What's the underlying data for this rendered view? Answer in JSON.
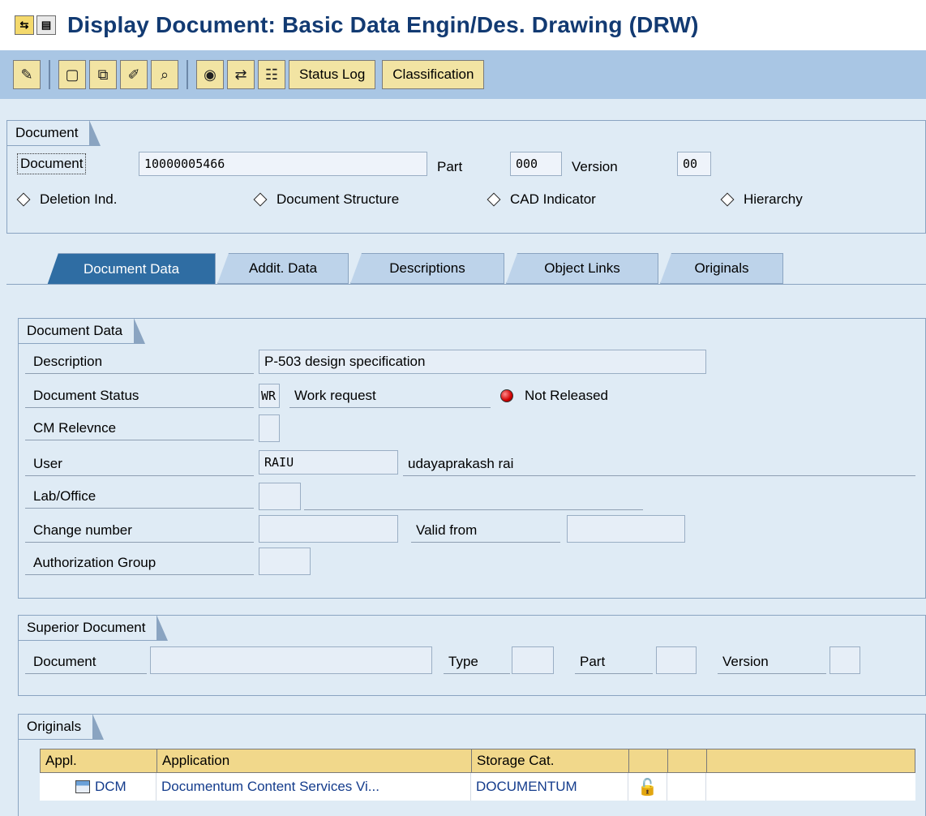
{
  "title": "Display Document: Basic Data Engin/Des. Drawing (DRW)",
  "toolbar": {
    "icons": [
      "edit-mode-icon",
      "new-document-icon",
      "copy-icon",
      "change-icon",
      "find-icon",
      "display-icon",
      "navigate-icon",
      "structure-icon"
    ],
    "status_log": "Status Log",
    "classification": "Classification"
  },
  "header": {
    "group_title": "Document",
    "document_label": "Document",
    "document_value": "10000005466",
    "part_label": "Part",
    "part_value": "000",
    "version_label": "Version",
    "version_value": "00",
    "deletion_ind": "Deletion Ind.",
    "document_structure": "Document Structure",
    "cad_indicator": "CAD Indicator",
    "hierarchy": "Hierarchy"
  },
  "tabs": [
    {
      "label": "Document Data",
      "active": true
    },
    {
      "label": "Addit. Data",
      "active": false
    },
    {
      "label": "Descriptions",
      "active": false
    },
    {
      "label": "Object Links",
      "active": false
    },
    {
      "label": "Originals",
      "active": false
    }
  ],
  "document_data": {
    "group_title": "Document Data",
    "description_label": "Description",
    "description_value": "P-503 design specification",
    "status_label": "Document Status",
    "status_code": "WR",
    "status_text": "Work request",
    "release_text": "Not Released",
    "cm_label": "CM Relevnce",
    "cm_value": "",
    "user_label": "User",
    "user_value": "RAIU",
    "user_name": "udayaprakash rai",
    "lab_label": "Lab/Office",
    "lab_value": "",
    "change_label": "Change number",
    "change_value": "",
    "valid_label": "Valid from",
    "valid_value": "",
    "auth_label": "Authorization Group",
    "auth_value": ""
  },
  "superior": {
    "group_title": "Superior Document",
    "document_label": "Document",
    "type_label": "Type",
    "part_label": "Part",
    "version_label": "Version"
  },
  "originals": {
    "group_title": "Originals",
    "columns": [
      "Appl.",
      "Application",
      "Storage Cat.",
      "",
      "",
      ""
    ],
    "rows": [
      {
        "appl": "DCM",
        "application": "Documentum Content Services Vi...",
        "storage": "DOCUMENTUM"
      }
    ]
  }
}
